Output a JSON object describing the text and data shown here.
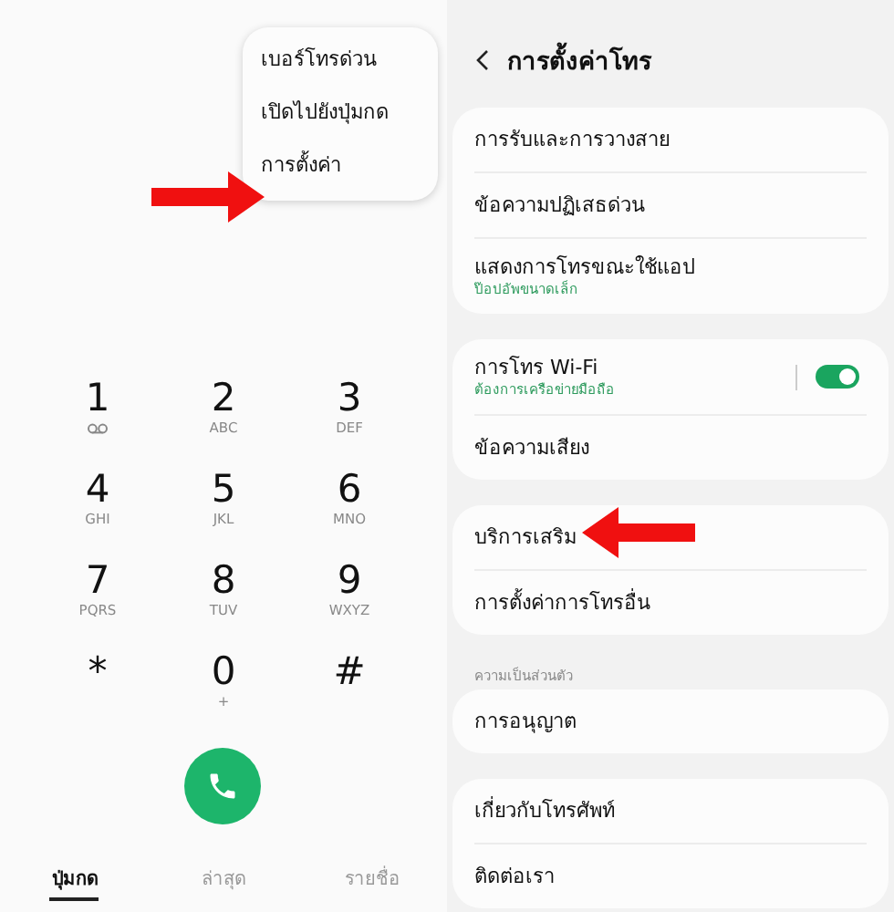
{
  "dialer": {
    "menu": [
      {
        "label": "เบอร์โทรด่วน"
      },
      {
        "label": "เปิดไปยังปุ่มกด"
      },
      {
        "label": "การตั้งค่า"
      }
    ],
    "keys": [
      {
        "digit": "1",
        "kind": "voicemail"
      },
      {
        "digit": "2",
        "letters": "ABC"
      },
      {
        "digit": "3",
        "letters": "DEF"
      },
      {
        "digit": "4",
        "letters": "GHI"
      },
      {
        "digit": "5",
        "letters": "JKL"
      },
      {
        "digit": "6",
        "letters": "MNO"
      },
      {
        "digit": "7",
        "letters": "PQRS"
      },
      {
        "digit": "8",
        "letters": "TUV"
      },
      {
        "digit": "9",
        "letters": "WXYZ"
      },
      {
        "digit": "*"
      },
      {
        "digit": "0",
        "letters": "+"
      },
      {
        "digit": "#"
      }
    ],
    "tabs": [
      {
        "label": "ปุ่มกด",
        "selected": true
      },
      {
        "label": "ล่าสุด",
        "selected": false
      },
      {
        "label": "รายชื่อ",
        "selected": false
      }
    ]
  },
  "settings": {
    "title": "การตั้งค่าโทร",
    "groups": [
      {
        "items": [
          {
            "label": "การรับและการวางสาย"
          },
          {
            "label": "ข้อความปฏิเสธด่วน"
          },
          {
            "label": "แสดงการโทรขณะใช้แอป",
            "subtitle": "ป๊อปอัพขนาดเล็ก"
          }
        ]
      },
      {
        "items": [
          {
            "label": "การโทร Wi-Fi",
            "subtitle": "ต้องการเครือข่ายมือถือ",
            "kind": "toggle",
            "on": true
          },
          {
            "label": "ข้อความเสียง"
          }
        ]
      },
      {
        "items": [
          {
            "label": "บริการเสริม"
          },
          {
            "label": "การตั้งค่าการโทรอื่น"
          }
        ]
      },
      {
        "header": "ความเป็นส่วนตัว",
        "items": [
          {
            "label": "การอนุญาต"
          }
        ]
      },
      {
        "items": [
          {
            "label": "เกี่ยวกับโทรศัพท์"
          },
          {
            "label": "ติดต่อเรา"
          }
        ]
      }
    ]
  }
}
